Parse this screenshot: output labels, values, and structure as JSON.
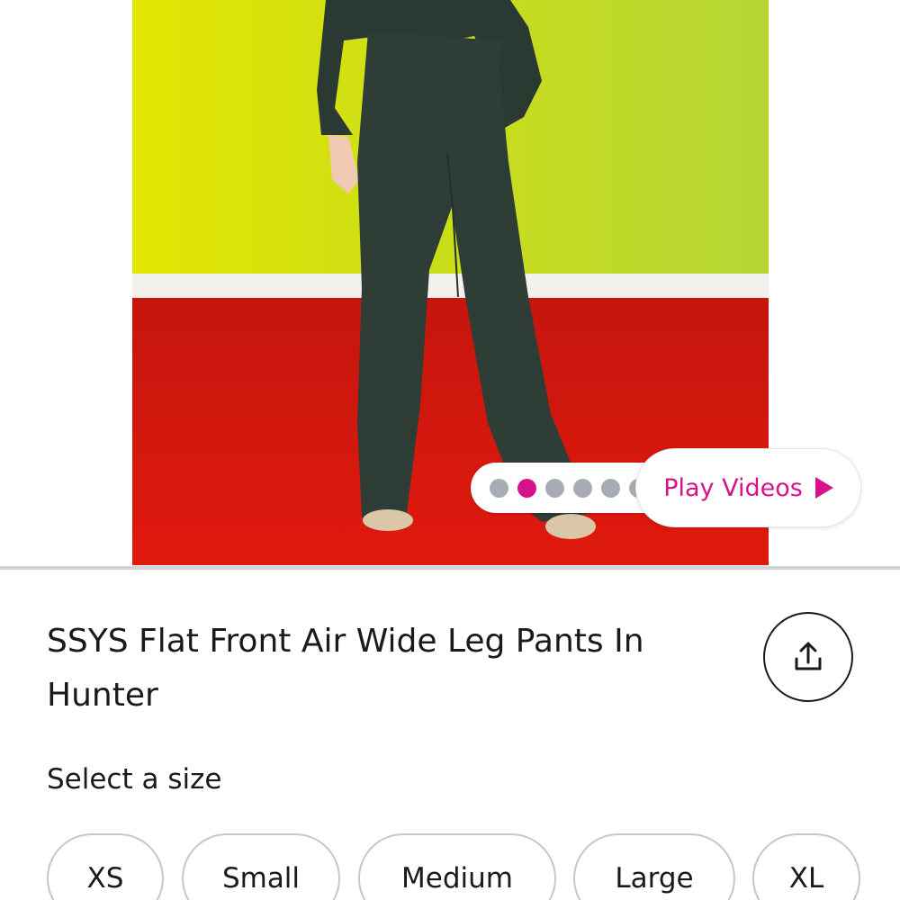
{
  "carousel": {
    "dot_count": 7,
    "active_index": 1
  },
  "play_videos": {
    "label": "Play Videos"
  },
  "product": {
    "title": "SSYS Flat Front Air Wide Leg Pants In Hunter"
  },
  "size_selector": {
    "label": "Select a size",
    "options": [
      "XS",
      "Small",
      "Medium",
      "Large",
      "XL"
    ]
  },
  "colors": {
    "accent": "#d6138a",
    "dot_inactive": "#a7acb4",
    "wall": "#d8e400",
    "floor": "#d7150c",
    "pants": "#2c3c33"
  },
  "icons": {
    "share": "share-icon",
    "play": "play-icon"
  }
}
